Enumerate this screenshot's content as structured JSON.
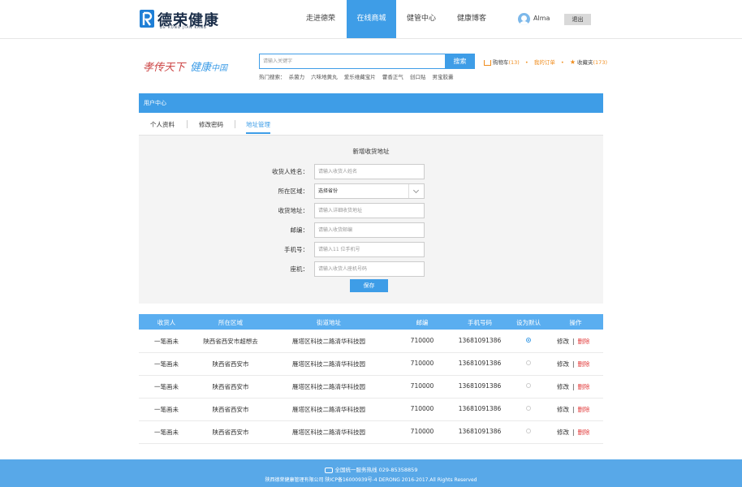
{
  "header": {
    "logo_text": "德荣健康",
    "logo_sub": "DE RONG JIAN KANG",
    "nav": [
      "走进德荣",
      "在线商城",
      "健管中心",
      "健康博客"
    ],
    "active_nav": "在线商城",
    "username": "Alma",
    "logout": "退出"
  },
  "brand": {
    "slogan_1": "孝传天下",
    "slogan_2": "健康",
    "slogan_3": "中国"
  },
  "search": {
    "placeholder": "请输入关键字",
    "button": "搜索",
    "hot_label": "热门搜索：",
    "hot_terms": [
      "杀菌力",
      "六味地黄丸",
      "爱乐维藏宝片",
      "藿香正气",
      "创口贴",
      "男宝胶囊"
    ]
  },
  "top_links": {
    "cart_label": "购物车",
    "cart_count": "(13)",
    "orders_label": "我的订单",
    "fav_label": "收藏夹",
    "fav_count": "(173)"
  },
  "user_center": {
    "title": "用户中心",
    "tabs": [
      "个人资料",
      "修改密码",
      "地址管理"
    ],
    "active_tab": "地址管理"
  },
  "form": {
    "title": "新增收货地址",
    "fields": [
      {
        "label": "收货人姓名：",
        "placeholder": "请输入收货人姓名"
      },
      {
        "label": "所在区域：",
        "value": "选择省份"
      },
      {
        "label": "收货地址：",
        "placeholder": "请输入详细收货地址"
      },
      {
        "label": "邮编：",
        "placeholder": "请输入收货邮编"
      },
      {
        "label": "手机号：",
        "placeholder": "请输入11 位手机号"
      },
      {
        "label": "座机：",
        "placeholder": "请输入收货人座机号码"
      }
    ],
    "save": "保存"
  },
  "table": {
    "headers": [
      "收货人",
      "所在区域",
      "街道地址",
      "邮编",
      "手机号码",
      "设为默认",
      "操作"
    ],
    "rows": [
      {
        "name": "一笔画未",
        "region": "陕西省西安市超想去",
        "street": "雁塔区科技二路清华科技园",
        "zip": "710000",
        "phone": "13681091386",
        "default": true
      },
      {
        "name": "一笔画未",
        "region": "陕西省西安市",
        "street": "雁塔区科技二路清华科技园",
        "zip": "710000",
        "phone": "13681091386",
        "default": false
      },
      {
        "name": "一笔画未",
        "region": "陕西省西安市",
        "street": "雁塔区科技二路清华科技园",
        "zip": "710000",
        "phone": "13681091386",
        "default": false
      },
      {
        "name": "一笔画未",
        "region": "陕西省西安市",
        "street": "雁塔区科技二路清华科技园",
        "zip": "710000",
        "phone": "13681091386",
        "default": false
      },
      {
        "name": "一笔画未",
        "region": "陕西省西安市",
        "street": "雁塔区科技二路清华科技园",
        "zip": "710000",
        "phone": "13681091386",
        "default": false
      }
    ],
    "edit": "修改",
    "sep": "|",
    "delete": "删除"
  },
  "footer": {
    "hotline": "全国统一服务热线 029-85358859",
    "copyright": "陕西德荣健康管理有限公司 陕ICP备16000939号-4  DERONG 2016-2017.All Rights Reserved"
  },
  "colors": {
    "accent": "#3e9de7",
    "orange": "#f08c1c",
    "delete": "#e23b3b"
  }
}
